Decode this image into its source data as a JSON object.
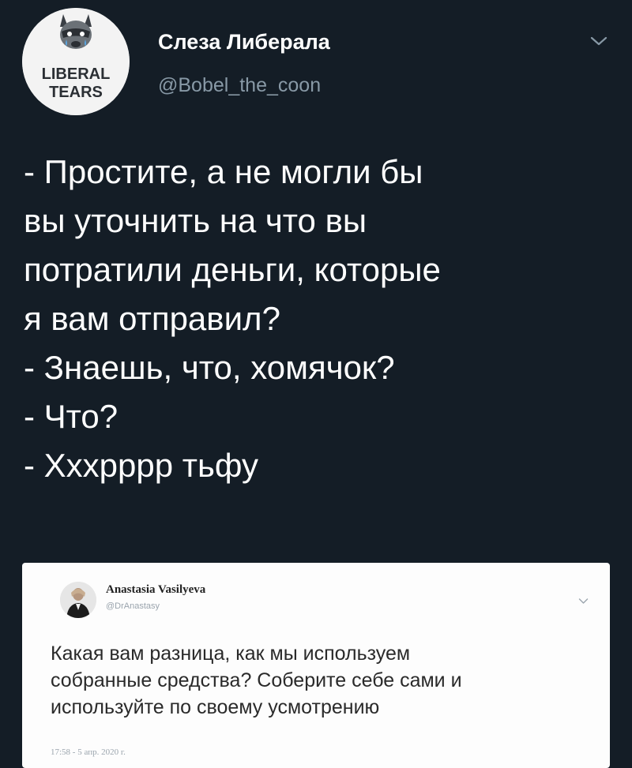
{
  "tweet": {
    "author": {
      "display_name": "Слеза Либерала",
      "handle": "@Bobel_the_coon",
      "avatar_text": [
        "LIBERAL",
        "TEARS"
      ]
    },
    "menu_icon": "chevron-down-icon",
    "text_lines": [
      "- Простите, а не могли бы",
      "вы уточнить на что вы",
      "потратили деньги, которые",
      "я вам отправил?",
      "- Знаешь, что, хомячок?",
      "- Что?",
      "- Хххрррр тьфу"
    ]
  },
  "embedded_tweet": {
    "author": {
      "display_name": "Anastasia Vasilyeva",
      "handle": "@DrAnastasy"
    },
    "menu_icon": "chevron-down-icon",
    "text_lines": [
      "Какая вам разница, как мы используем",
      "собранные средства? Соберите себе сами и",
      "используйте по своему усмотрению"
    ],
    "timestamp": "17:58 - 5 апр. 2020 г."
  },
  "colors": {
    "background": "#141d26",
    "text_primary": "#ffffff",
    "text_secondary": "#8899a6",
    "embed_background": "#fdfdfd",
    "embed_text": "#2a2a2a"
  }
}
